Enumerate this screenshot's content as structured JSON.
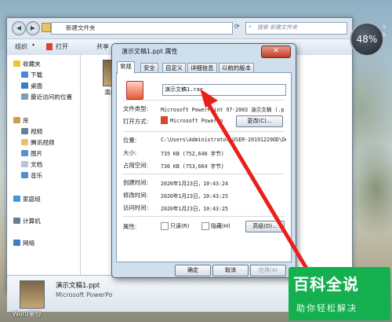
{
  "explorer": {
    "address": "新建文件夹",
    "search_placeholder": "搜索 新建文件夹",
    "toolbar": {
      "organize": "组织",
      "open": "打开",
      "share": "共享"
    },
    "nav": {
      "favorites": "收藏夹",
      "downloads": "下载",
      "desktop": "桌面",
      "recent": "最近访问的位置",
      "library": "库",
      "videos": "视频",
      "tencent_video": "腾讯视频",
      "pictures": "图片",
      "documents": "文档",
      "music": "音乐",
      "homegroup": "家庭组",
      "computer": "计算机",
      "network": "网络"
    },
    "content_file_label": "演示",
    "details": {
      "filename": "演示文稿1.ppt",
      "filetype": "Microsoft PowerPo"
    }
  },
  "dialog": {
    "title": "演示文稿1.ppt 属性",
    "close_symbol": "✕",
    "tabs": [
      "常规",
      "安全",
      "自定义",
      "详细信息",
      "以前的版本"
    ],
    "name_value": "演示文稿1.rar",
    "labels": {
      "file_type": "文件类型:",
      "open_with": "打开方式:",
      "location": "位置:",
      "size": "大小:",
      "size_on_disk": "占用空间:",
      "created": "创建时间:",
      "modified": "修改时间:",
      "accessed": "访问时间:",
      "attributes": "属性:"
    },
    "values": {
      "file_type": "Microsoft PowerPoint 97-2003 演示文稿 (.p",
      "open_with": "Microsoft PowerPo",
      "location": "C:\\Users\\Administrator.USER-20191229OD\\De",
      "size": "735 KB (752,640 字节)",
      "size_on_disk": "736 KB (753,664 字节)",
      "created": "2020年1月23日，10:43:24",
      "modified": "2020年1月23日，10:43:25",
      "accessed": "2020年1月23日，10:43:25"
    },
    "change_button": "更改(C)...",
    "readonly_label": "只读(R)",
    "hidden_label": "隐藏(H)",
    "advanced_button": "高级(D)...",
    "ok_button": "确定",
    "cancel_button": "取消",
    "apply_button": "应用(A)"
  },
  "gadget": {
    "percent": "48%",
    "stat1": "1.",
    "stat2": "1."
  },
  "watermark": {
    "title": "百科全说",
    "subtitle": "助你轻松解决"
  },
  "taskbar_label": "Word备份",
  "colors": {
    "accent_red": "#e8201a",
    "watermark_green": "#14b050"
  }
}
